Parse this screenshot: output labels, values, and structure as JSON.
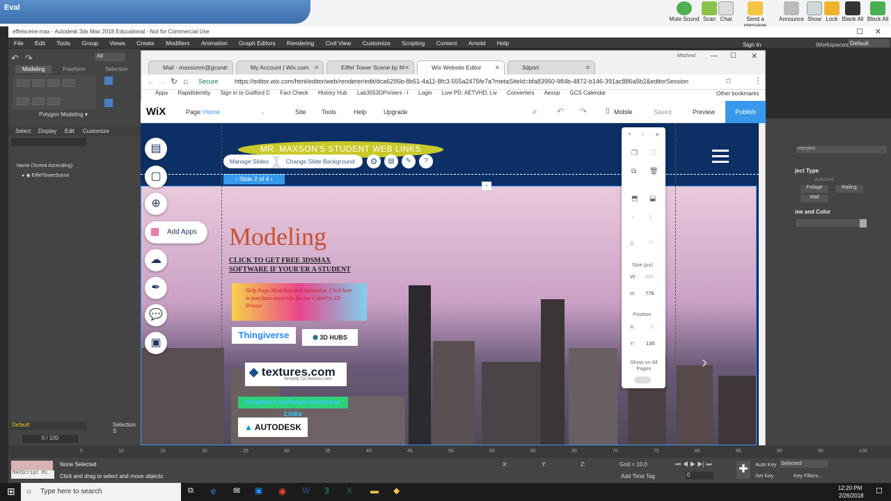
{
  "eval": {
    "label": "Eval"
  },
  "tray": [
    "Mute Sound",
    "Scan",
    "Chat",
    "Send a message",
    "Announce",
    "Show",
    "Lock",
    "Blank All",
    "Block All"
  ],
  "max": {
    "title": "effelscene.max - Autodesk 3ds Max 2018 Educational - Not for Commercial Use",
    "menus": [
      "File",
      "Edit",
      "Tools",
      "Group",
      "Views",
      "Create",
      "Modifiers",
      "Animation",
      "Graph Editors",
      "Rendering",
      "Civil View",
      "Customize",
      "Scripting",
      "Content",
      "Arnold",
      "Help"
    ],
    "signin": "Sign In",
    "workspaces_label": "Workspaces:",
    "workspace_value": "Default",
    "ribbon_tabs": [
      "Modeling",
      "Freeform",
      "Selection"
    ],
    "polygon_modeling": "Polygon Modeling",
    "scene_tabs": [
      "Select",
      "Display",
      "Edit",
      "Customize"
    ],
    "sort_label": "Name (Sorted Ascending)",
    "tree_item": "EiffelTowerScene",
    "all_label": "All",
    "layer": "Default",
    "selection_set": "Selection S",
    "frames": "0 / 100",
    "ticks": [
      "5",
      "10",
      "15",
      "20",
      "25",
      "30",
      "35",
      "40",
      "45",
      "50",
      "55",
      "60",
      "65",
      "70",
      "75",
      "80",
      "85",
      "90",
      "95",
      "100"
    ],
    "none_selected": "None Selected",
    "hint": "Click and drag to select and move objects",
    "maxscript": "MAXScript Mi",
    "x_label": "X:",
    "y_label": "Y:",
    "z_label": "Z:",
    "grid": "Grid = 10.0",
    "add_time_tag": "Add Time Tag",
    "auto_key": "Auto Key",
    "set_key": "Set Key",
    "selected": "Selected",
    "key_filters": "Key Filters...",
    "frame_value": "0",
    "obj_type": "ject Type",
    "autogrid": "AutoGrid",
    "foliage": "Foliage",
    "railing": "Railing",
    "wall": "Wall",
    "name_color": "me and Color",
    "extended": "xtended"
  },
  "browser": {
    "window_user": "Mitchnol",
    "tabs": [
      {
        "label": "Mail - maxsonm@gcsnc"
      },
      {
        "label": "My Account | Wix.com"
      },
      {
        "label": "Eiffel Tower Scene by M"
      },
      {
        "label": "Wix Website Editor"
      },
      {
        "label": "3dport"
      }
    ],
    "secure": "Secure",
    "url": "https://editor.wix.com/html/editor/web/renderer/edit/dca6295b-8b51-4a11-8fc3-555a2475fe7a?metaSiteId=bfa83950-984b-4872-b146-391ac886a5b2&editorSession",
    "bookmarks": [
      "Apps",
      "RapidIdentity",
      "Sign in to Guilford C",
      "Fact Check",
      "History Hub",
      "Lab3053DPrinters - I",
      "Login",
      "Live PD, AETVHD, Liv",
      "Converters",
      "Aesop",
      "GCS Calendar"
    ],
    "other_bookmarks": "Other bookmarks"
  },
  "wix": {
    "logo": "WiX",
    "page_label": "Page:",
    "page_value": "Home",
    "nav": [
      "Site",
      "Tools",
      "Help",
      "Upgrade"
    ],
    "mobile": "Mobile",
    "saved": "Saved",
    "preview": "Preview",
    "publish": "Publish",
    "banner": "MR. MAXSON'S STUDENT WEB LINKS",
    "manage_slides": "Manage Slides",
    "change_bg": "Change Slide Background",
    "slide_indicator": "Slide 2 of 4",
    "add_apps": "Add Apps",
    "heading": "Modeling",
    "subheading_1": "CLICK TO GET FREE 3DSMAX",
    "subheading_2": "SOFTWARE IF YOUR'ER A STUDENT",
    "promo": "Help Page Modeling and Animation. Click here to purchase materials for our CubePro 3D Printer",
    "thingiverse": "Thingiverse",
    "hubs": "3D HUBS",
    "textures": "textures.com",
    "textures_sub": "formerly CGTextures.com",
    "graphics_link": "Graphics Software Purchase Links",
    "autodesk": "AUTODESK",
    "inspector": {
      "size_label": "Size (px)",
      "w_label": "W:",
      "w_value": "980",
      "h_label": "H:",
      "h_value": "776",
      "angle": "0°",
      "position_label": "Position",
      "x_label": "X:",
      "x_value": "0",
      "y_label": "Y:",
      "y_value": "135",
      "show_all": "Show on All Pages"
    }
  },
  "taskbar": {
    "search": "Type here to search",
    "time": "12:20 PM",
    "date": "2/26/2018"
  }
}
